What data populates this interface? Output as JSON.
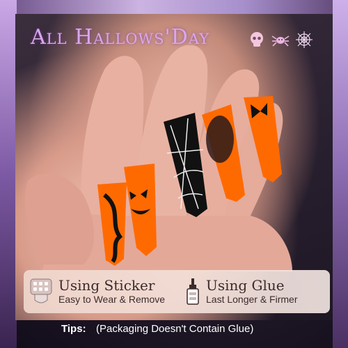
{
  "header": {
    "title": "All Hallows'Day",
    "icons": [
      "skull-icon",
      "spider-icon",
      "spiderweb-icon"
    ],
    "title_color": "#d9a7ea"
  },
  "usage": {
    "sticker": {
      "title": "Using Sticker",
      "subtitle": "Easy to Wear & Remove",
      "icon": "sticker-tab-icon"
    },
    "glue": {
      "title": "Using Glue",
      "subtitle": "Last Longer & Firmer",
      "icon": "glue-bottle-icon"
    }
  },
  "tips": {
    "label": "Tips:",
    "text": "(Packaging Doesn't Contain Glue)"
  },
  "colors": {
    "nail_orange": "#ff6a00",
    "nail_black": "#111111",
    "frame_purple": "#a78fcc"
  }
}
